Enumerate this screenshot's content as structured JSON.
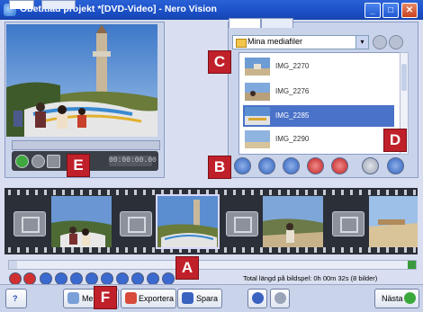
{
  "window": {
    "title": "Obetitlad projekt *[DVD-Video] - Nero Vision",
    "minimize_glyph": "_",
    "maximize_glyph": "□",
    "close_glyph": "✕"
  },
  "preview": {
    "timecode": "00:00:00.00"
  },
  "media": {
    "folder_label": "Mina mediafiler",
    "dropdown_arrow": "▾",
    "items": [
      {
        "name": "IMG_2270",
        "selected": false
      },
      {
        "name": "IMG_2276",
        "selected": false
      },
      {
        "name": "IMG_2285",
        "selected": true
      },
      {
        "name": "IMG_2290",
        "selected": false
      }
    ]
  },
  "badges": {
    "a": "A",
    "b": "B",
    "c": "C",
    "d": "D",
    "e": "E",
    "f": "F"
  },
  "timeline": {
    "total_text": "Total längd på bildspel: 0h 00m 32s (8 bilder)"
  },
  "bottom": {
    "help_glyph": "?",
    "more_label": "Mer",
    "export_label": "Exportera",
    "save_label": "Spara",
    "next_label": "Nästa"
  },
  "colors": {
    "accent": "#2a62d6",
    "badge": "#c0202a",
    "selection": "#4a72c8"
  }
}
